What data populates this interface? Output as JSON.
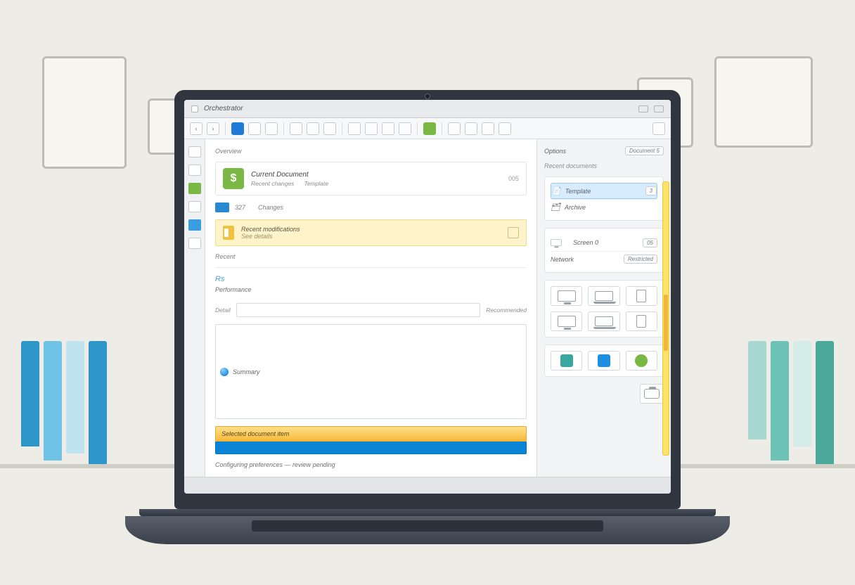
{
  "titlebar": {
    "app_name": "Orchestrator"
  },
  "center": {
    "section_label": "Overview",
    "card1": {
      "title": "Current Document",
      "sub1": "Recent changes",
      "sub2": "Template",
      "meta": "005"
    },
    "mini": {
      "count_label": "327",
      "label": "Changes"
    },
    "notice": {
      "line1": "Recent modifications",
      "line2": "See details"
    },
    "section2_label": "Recent",
    "pale": {
      "head_small": "Rs",
      "head": "Performance"
    },
    "field_label": "Detail",
    "field2_label": "Summary",
    "field_meta": "Recommended",
    "selected_label": "Selected document item",
    "status_text": "Configuring preferences — review pending"
  },
  "rpanel": {
    "header": "Options",
    "tab_label": "Document 5",
    "group1_label": "Recent documents",
    "group1": {
      "row1": {
        "label": "Template",
        "badge": "3"
      },
      "row2": {
        "label": "Archive"
      }
    },
    "group2": {
      "row1": {
        "label": "Screen 0",
        "badge": "05"
      },
      "row2": {
        "label": "Network",
        "badge2": "Restricted"
      }
    }
  },
  "colors": {
    "green": "#7ab845",
    "blue": "#1f8fe0",
    "gold": "#f4c043",
    "teal": "#3aa7a0"
  }
}
